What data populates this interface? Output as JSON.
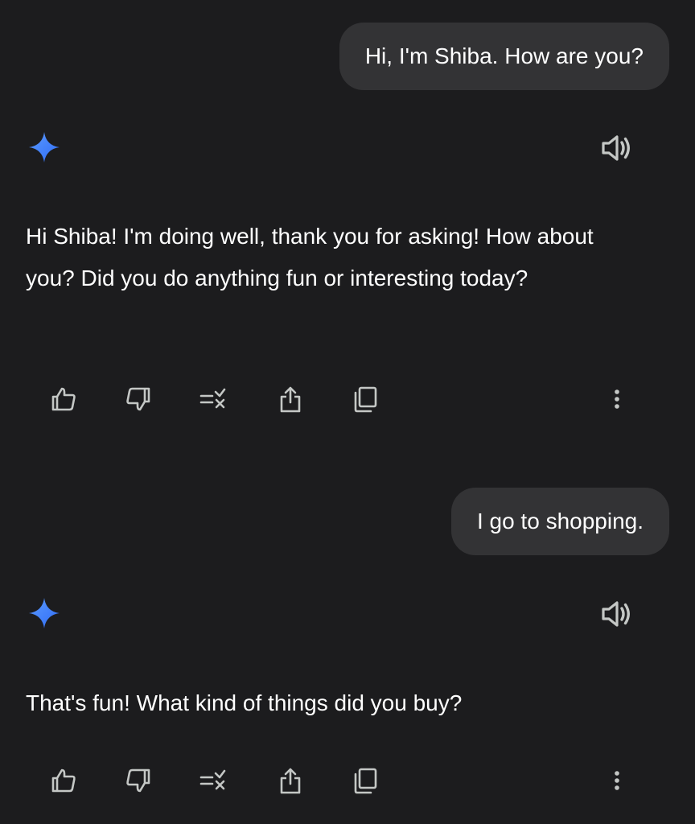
{
  "conversation": {
    "messages": [
      {
        "role": "user",
        "text": "Hi, I'm Shiba. How are you?"
      },
      {
        "role": "assistant",
        "text": "Hi Shiba! I'm doing well, thank you for asking! How about you? Did you do anything fun or interesting today?"
      },
      {
        "role": "user",
        "text": "I go to shopping."
      },
      {
        "role": "assistant",
        "text": "That's fun! What kind of things did you buy?"
      }
    ]
  },
  "icons": {
    "assistant_avatar": "gemini-sparkle-icon",
    "read_aloud": "speaker-icon",
    "actions": [
      "thumbs-up-icon",
      "thumbs-down-icon",
      "modify-response-icon",
      "share-icon",
      "copy-icon",
      "more-vert-icon"
    ]
  },
  "colors": {
    "background": "#1c1c1e",
    "user_bubble": "#333335",
    "text": "#ffffff",
    "icon": "#c4c7c5",
    "sparkle_start": "#4a8cff",
    "sparkle_end": "#2f6bf5"
  }
}
